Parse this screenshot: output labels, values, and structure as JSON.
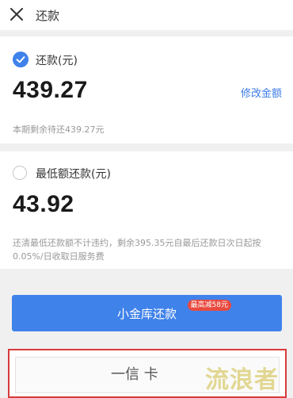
{
  "header": {
    "close_icon": "close-icon",
    "title": "还款"
  },
  "option_full": {
    "selected": true,
    "label": "还款(元)",
    "amount": "439.27",
    "edit_link": "修改金额",
    "note": "本期剩余待还439.27元"
  },
  "option_min": {
    "selected": false,
    "label": "最低额还款(元)",
    "amount": "43.92",
    "note_line1": "还清最低还款额不计违约，剩余395.35元自最后还款日次日起按",
    "note_line2": "0.05%/日收取日服务费"
  },
  "pay": {
    "button_label": "小金库还款",
    "badge": "最高减58元"
  },
  "bottom": {
    "partial_text": "一信 卡"
  },
  "watermark": "流浪者",
  "colors": {
    "accent": "#3f82ea",
    "badge": "#e94a3f",
    "highlight_border": "#d83a3a"
  }
}
